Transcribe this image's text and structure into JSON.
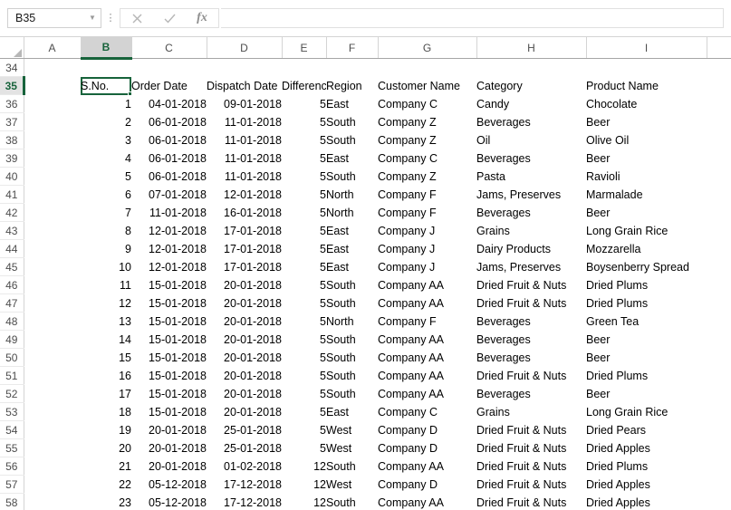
{
  "formula_bar": {
    "name_box_value": "B35",
    "name_box_icon": "chevron-down-icon",
    "cancel_icon": "cancel-x-icon",
    "confirm_icon": "check-icon",
    "function_icon": "fx-icon",
    "function_label": "fx",
    "formula_value": "",
    "more_options_icon": "vertical-dots-icon",
    "more_options_glyph": "⋮"
  },
  "grid": {
    "corner_icon": "select-all-triangle-icon",
    "active_cell": "B35",
    "active_column": "B",
    "active_row": "35",
    "accent_color": "#17633b",
    "column_letters": [
      "A",
      "B",
      "C",
      "D",
      "E",
      "F",
      "G",
      "H",
      "I"
    ],
    "headers": {
      "row_number": "35",
      "s_no": "S.No.",
      "order_date": "Order Date",
      "dispatch_date": "Dispatch Date",
      "difference": "Difference",
      "region": "Region",
      "customer_name": "Customer Name",
      "category": "Category",
      "product_name": "Product Name"
    },
    "empty_row_number": "34",
    "rows": [
      {
        "row": "36",
        "s_no": "1",
        "order_date": "04-01-2018",
        "dispatch_date": "09-01-2018",
        "difference": "5",
        "region": "East",
        "customer": "Company C",
        "category": "Candy",
        "product": "Chocolate"
      },
      {
        "row": "37",
        "s_no": "2",
        "order_date": "06-01-2018",
        "dispatch_date": "11-01-2018",
        "difference": "5",
        "region": "South",
        "customer": "Company Z",
        "category": "Beverages",
        "product": "Beer"
      },
      {
        "row": "38",
        "s_no": "3",
        "order_date": "06-01-2018",
        "dispatch_date": "11-01-2018",
        "difference": "5",
        "region": "South",
        "customer": "Company Z",
        "category": "Oil",
        "product": "Olive Oil"
      },
      {
        "row": "39",
        "s_no": "4",
        "order_date": "06-01-2018",
        "dispatch_date": "11-01-2018",
        "difference": "5",
        "region": "East",
        "customer": "Company C",
        "category": "Beverages",
        "product": "Beer"
      },
      {
        "row": "40",
        "s_no": "5",
        "order_date": "06-01-2018",
        "dispatch_date": "11-01-2018",
        "difference": "5",
        "region": "South",
        "customer": "Company Z",
        "category": "Pasta",
        "product": "Ravioli"
      },
      {
        "row": "41",
        "s_no": "6",
        "order_date": "07-01-2018",
        "dispatch_date": "12-01-2018",
        "difference": "5",
        "region": "North",
        "customer": "Company F",
        "category": "Jams, Preserves",
        "product": "Marmalade"
      },
      {
        "row": "42",
        "s_no": "7",
        "order_date": "11-01-2018",
        "dispatch_date": "16-01-2018",
        "difference": "5",
        "region": "North",
        "customer": "Company F",
        "category": "Beverages",
        "product": "Beer"
      },
      {
        "row": "43",
        "s_no": "8",
        "order_date": "12-01-2018",
        "dispatch_date": "17-01-2018",
        "difference": "5",
        "region": "East",
        "customer": "Company J",
        "category": "Grains",
        "product": "Long Grain Rice"
      },
      {
        "row": "44",
        "s_no": "9",
        "order_date": "12-01-2018",
        "dispatch_date": "17-01-2018",
        "difference": "5",
        "region": "East",
        "customer": "Company J",
        "category": "Dairy Products",
        "product": "Mozzarella"
      },
      {
        "row": "45",
        "s_no": "10",
        "order_date": "12-01-2018",
        "dispatch_date": "17-01-2018",
        "difference": "5",
        "region": "East",
        "customer": "Company J",
        "category": "Jams, Preserves",
        "product": "Boysenberry Spread"
      },
      {
        "row": "46",
        "s_no": "11",
        "order_date": "15-01-2018",
        "dispatch_date": "20-01-2018",
        "difference": "5",
        "region": "South",
        "customer": "Company AA",
        "category": "Dried Fruit & Nuts",
        "product": "Dried Plums"
      },
      {
        "row": "47",
        "s_no": "12",
        "order_date": "15-01-2018",
        "dispatch_date": "20-01-2018",
        "difference": "5",
        "region": "South",
        "customer": "Company AA",
        "category": "Dried Fruit & Nuts",
        "product": "Dried Plums"
      },
      {
        "row": "48",
        "s_no": "13",
        "order_date": "15-01-2018",
        "dispatch_date": "20-01-2018",
        "difference": "5",
        "region": "North",
        "customer": "Company F",
        "category": "Beverages",
        "product": "Green Tea"
      },
      {
        "row": "49",
        "s_no": "14",
        "order_date": "15-01-2018",
        "dispatch_date": "20-01-2018",
        "difference": "5",
        "region": "South",
        "customer": "Company AA",
        "category": "Beverages",
        "product": "Beer"
      },
      {
        "row": "50",
        "s_no": "15",
        "order_date": "15-01-2018",
        "dispatch_date": "20-01-2018",
        "difference": "5",
        "region": "South",
        "customer": "Company AA",
        "category": "Beverages",
        "product": "Beer"
      },
      {
        "row": "51",
        "s_no": "16",
        "order_date": "15-01-2018",
        "dispatch_date": "20-01-2018",
        "difference": "5",
        "region": "South",
        "customer": "Company AA",
        "category": "Dried Fruit & Nuts",
        "product": "Dried Plums"
      },
      {
        "row": "52",
        "s_no": "17",
        "order_date": "15-01-2018",
        "dispatch_date": "20-01-2018",
        "difference": "5",
        "region": "South",
        "customer": "Company AA",
        "category": "Beverages",
        "product": "Beer"
      },
      {
        "row": "53",
        "s_no": "18",
        "order_date": "15-01-2018",
        "dispatch_date": "20-01-2018",
        "difference": "5",
        "region": "East",
        "customer": "Company C",
        "category": "Grains",
        "product": "Long Grain Rice"
      },
      {
        "row": "54",
        "s_no": "19",
        "order_date": "20-01-2018",
        "dispatch_date": "25-01-2018",
        "difference": "5",
        "region": "West",
        "customer": "Company D",
        "category": "Dried Fruit & Nuts",
        "product": "Dried Pears"
      },
      {
        "row": "55",
        "s_no": "20",
        "order_date": "20-01-2018",
        "dispatch_date": "25-01-2018",
        "difference": "5",
        "region": "West",
        "customer": "Company D",
        "category": "Dried Fruit & Nuts",
        "product": "Dried Apples"
      },
      {
        "row": "56",
        "s_no": "21",
        "order_date": "20-01-2018",
        "dispatch_date": "01-02-2018",
        "difference": "12",
        "region": "South",
        "customer": "Company AA",
        "category": "Dried Fruit & Nuts",
        "product": "Dried Plums"
      },
      {
        "row": "57",
        "s_no": "22",
        "order_date": "05-12-2018",
        "dispatch_date": "17-12-2018",
        "difference": "12",
        "region": "West",
        "customer": "Company D",
        "category": "Dried Fruit & Nuts",
        "product": "Dried Apples"
      },
      {
        "row": "58",
        "s_no": "23",
        "order_date": "05-12-2018",
        "dispatch_date": "17-12-2018",
        "difference": "12",
        "region": "South",
        "customer": "Company AA",
        "category": "Dried Fruit & Nuts",
        "product": "Dried Apples"
      }
    ]
  }
}
